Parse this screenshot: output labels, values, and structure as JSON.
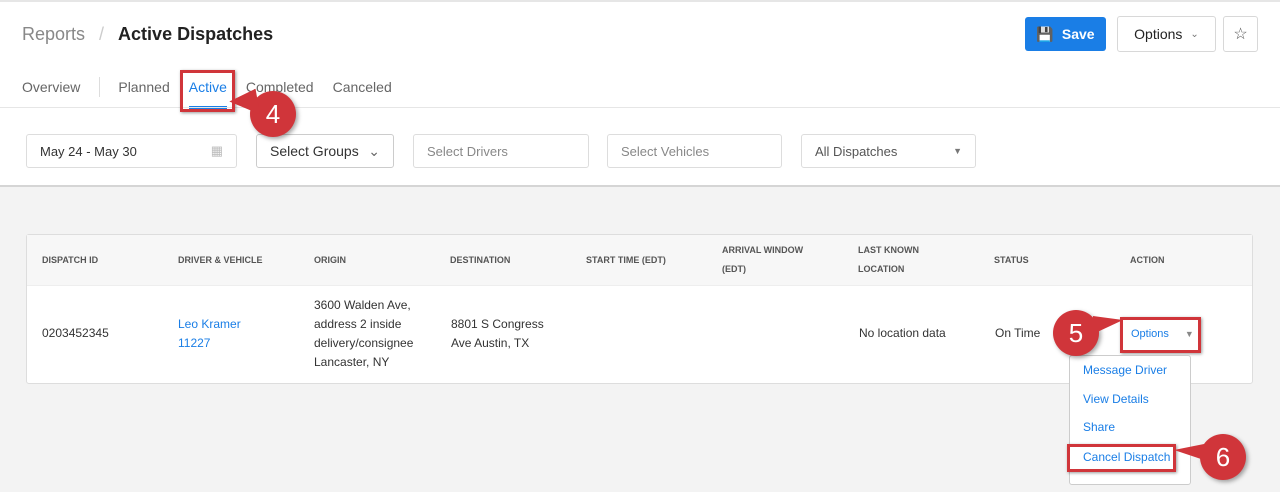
{
  "breadcrumb": {
    "parent": "Reports",
    "separator": "/",
    "current": "Active Dispatches"
  },
  "header": {
    "save_label": "Save",
    "options_label": "Options"
  },
  "tabs": [
    {
      "label": "Overview"
    },
    {
      "label": "Planned"
    },
    {
      "label": "Active"
    },
    {
      "label": "Completed"
    },
    {
      "label": "Canceled"
    }
  ],
  "filters": {
    "date_range": "May 24 - May 30",
    "groups": "Select Groups",
    "drivers_placeholder": "Select Drivers",
    "vehicles_placeholder": "Select Vehicles",
    "dispatch_filter": "All Dispatches"
  },
  "table": {
    "columns": [
      "DISPATCH ID",
      "DRIVER & VEHICLE",
      "ORIGIN",
      "DESTINATION",
      "START TIME (EDT)",
      "ARRIVAL WINDOW (EDT)",
      "LAST KNOWN LOCATION",
      "STATUS",
      "ACTION"
    ],
    "rows": [
      {
        "dispatch_id": "0203452345",
        "driver": "Leo Kramer",
        "vehicle": "11227",
        "origin": [
          "3600 Walden Ave,",
          "address 2 inside",
          "delivery/consignee",
          "Lancaster, NY"
        ],
        "destination": [
          "8801 S Congress",
          "Ave Austin, TX"
        ],
        "start_time": "",
        "arrival_window": "",
        "last_location": "No location data",
        "status": "On Time",
        "action": "Options"
      }
    ]
  },
  "action_menu": [
    "Message Driver",
    "View Details",
    "Share",
    "Cancel Dispatch"
  ],
  "callouts": [
    "4",
    "5",
    "6"
  ],
  "colors": {
    "accent": "#1a7ee6",
    "callout": "#d0353a"
  }
}
